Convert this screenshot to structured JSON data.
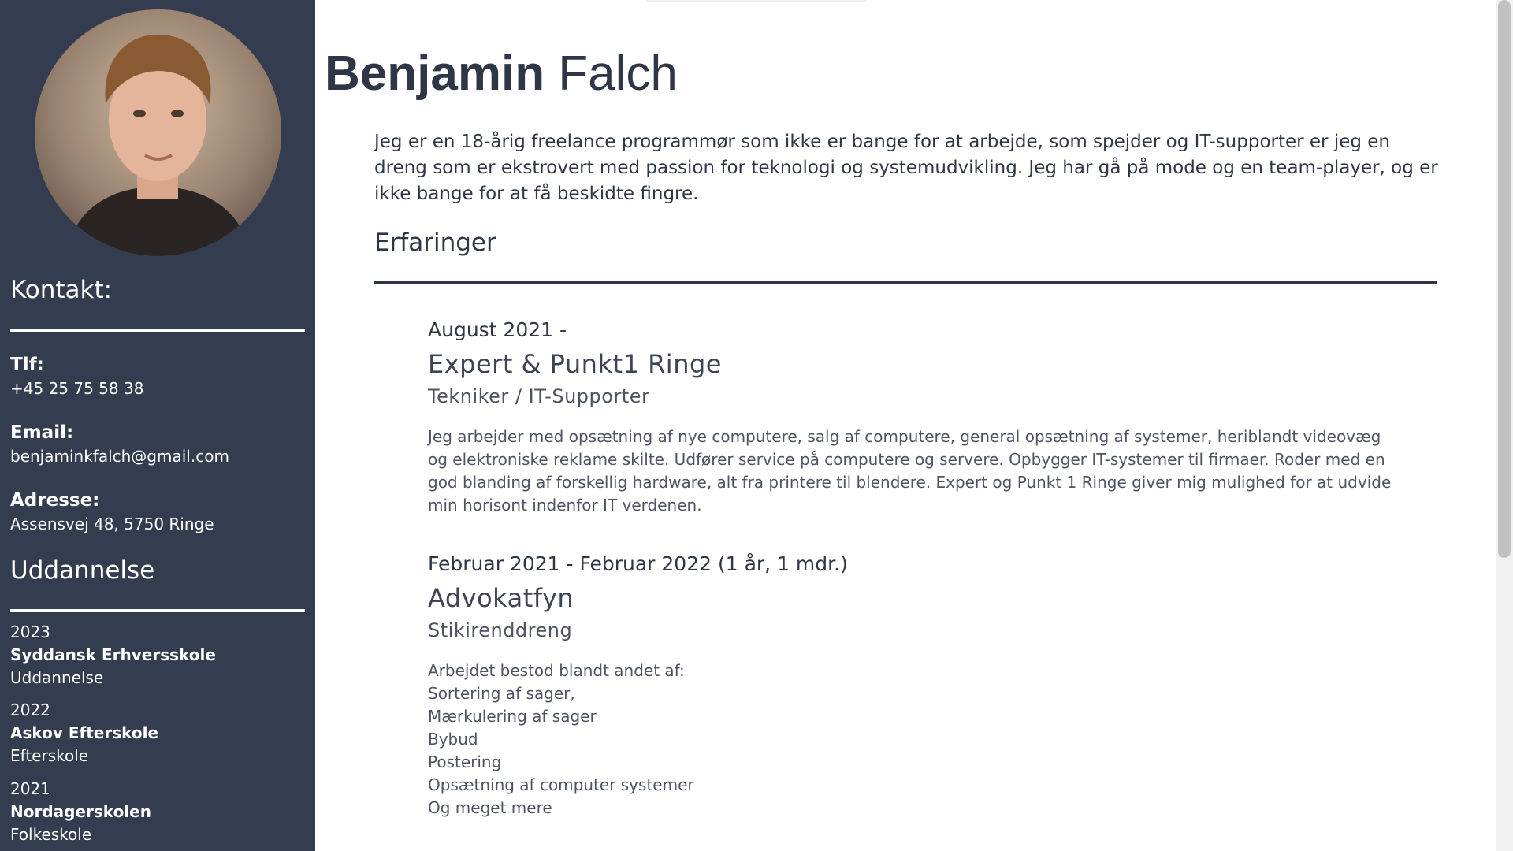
{
  "sidebar": {
    "contact_heading": "Kontakt:",
    "phone_label": "Tlf:",
    "phone_value": "+45 25 75 58 38",
    "email_label": "Email:",
    "email_value": "benjaminkfalch@gmail.com",
    "address_label": "Adresse:",
    "address_value": "Assensvej 48, 5750 Ringe",
    "education_heading": "Uddannelse",
    "education": [
      {
        "year": "2023",
        "school": "Syddansk Erhversskole",
        "type": "Uddannelse"
      },
      {
        "year": "2022",
        "school": "Askov Efterskole",
        "type": "Efterskole"
      },
      {
        "year": "2021",
        "school": "Nordagerskolen",
        "type": "Folkeskole"
      }
    ]
  },
  "header": {
    "first_name": "Benjamin",
    "last_name": "Falch"
  },
  "intro": "Jeg er en 18-årig freelance programmør som ikke er bange for at arbejde, som spejder og IT-supporter er jeg en dreng som er ekstrovert med passion for teknologi og systemudvikling. Jeg har gå på mode og en team-player, og er ikke bange for at få beskidte fingre.",
  "experience": {
    "heading": "Erfaringer",
    "jobs": [
      {
        "date": "August 2021 -",
        "company": "Expert & Punkt1 Ringe",
        "role": "Tekniker / IT-Supporter",
        "description": "Jeg arbejder med opsætning af nye computere, salg af computere, general opsætning af systemer, heriblandt videovæg og elektroniske reklame skilte. Udfører service på computere og servere. Opbygger IT-systemer til firmaer. Roder med en god blanding af forskellig hardware, alt fra printere til blendere. Expert og Punkt 1 Ringe giver mig mulighed for at udvide min horisont indenfor IT verdenen."
      },
      {
        "date": "Februar 2021 - Februar 2022 (1 år, 1 mdr.)",
        "company": "Advokatfyn",
        "role": "Stikirenddreng",
        "lines": [
          "Arbejdet bestod blandt andet af:",
          "Sortering af sager,",
          "Mærkulering af sager",
          "Bybud",
          "Postering",
          "Opsætning af computer systemer",
          "Og meget mere"
        ]
      }
    ]
  },
  "colors": {
    "sidebar_bg": "#343d4f",
    "text_dark": "#2f3747"
  }
}
